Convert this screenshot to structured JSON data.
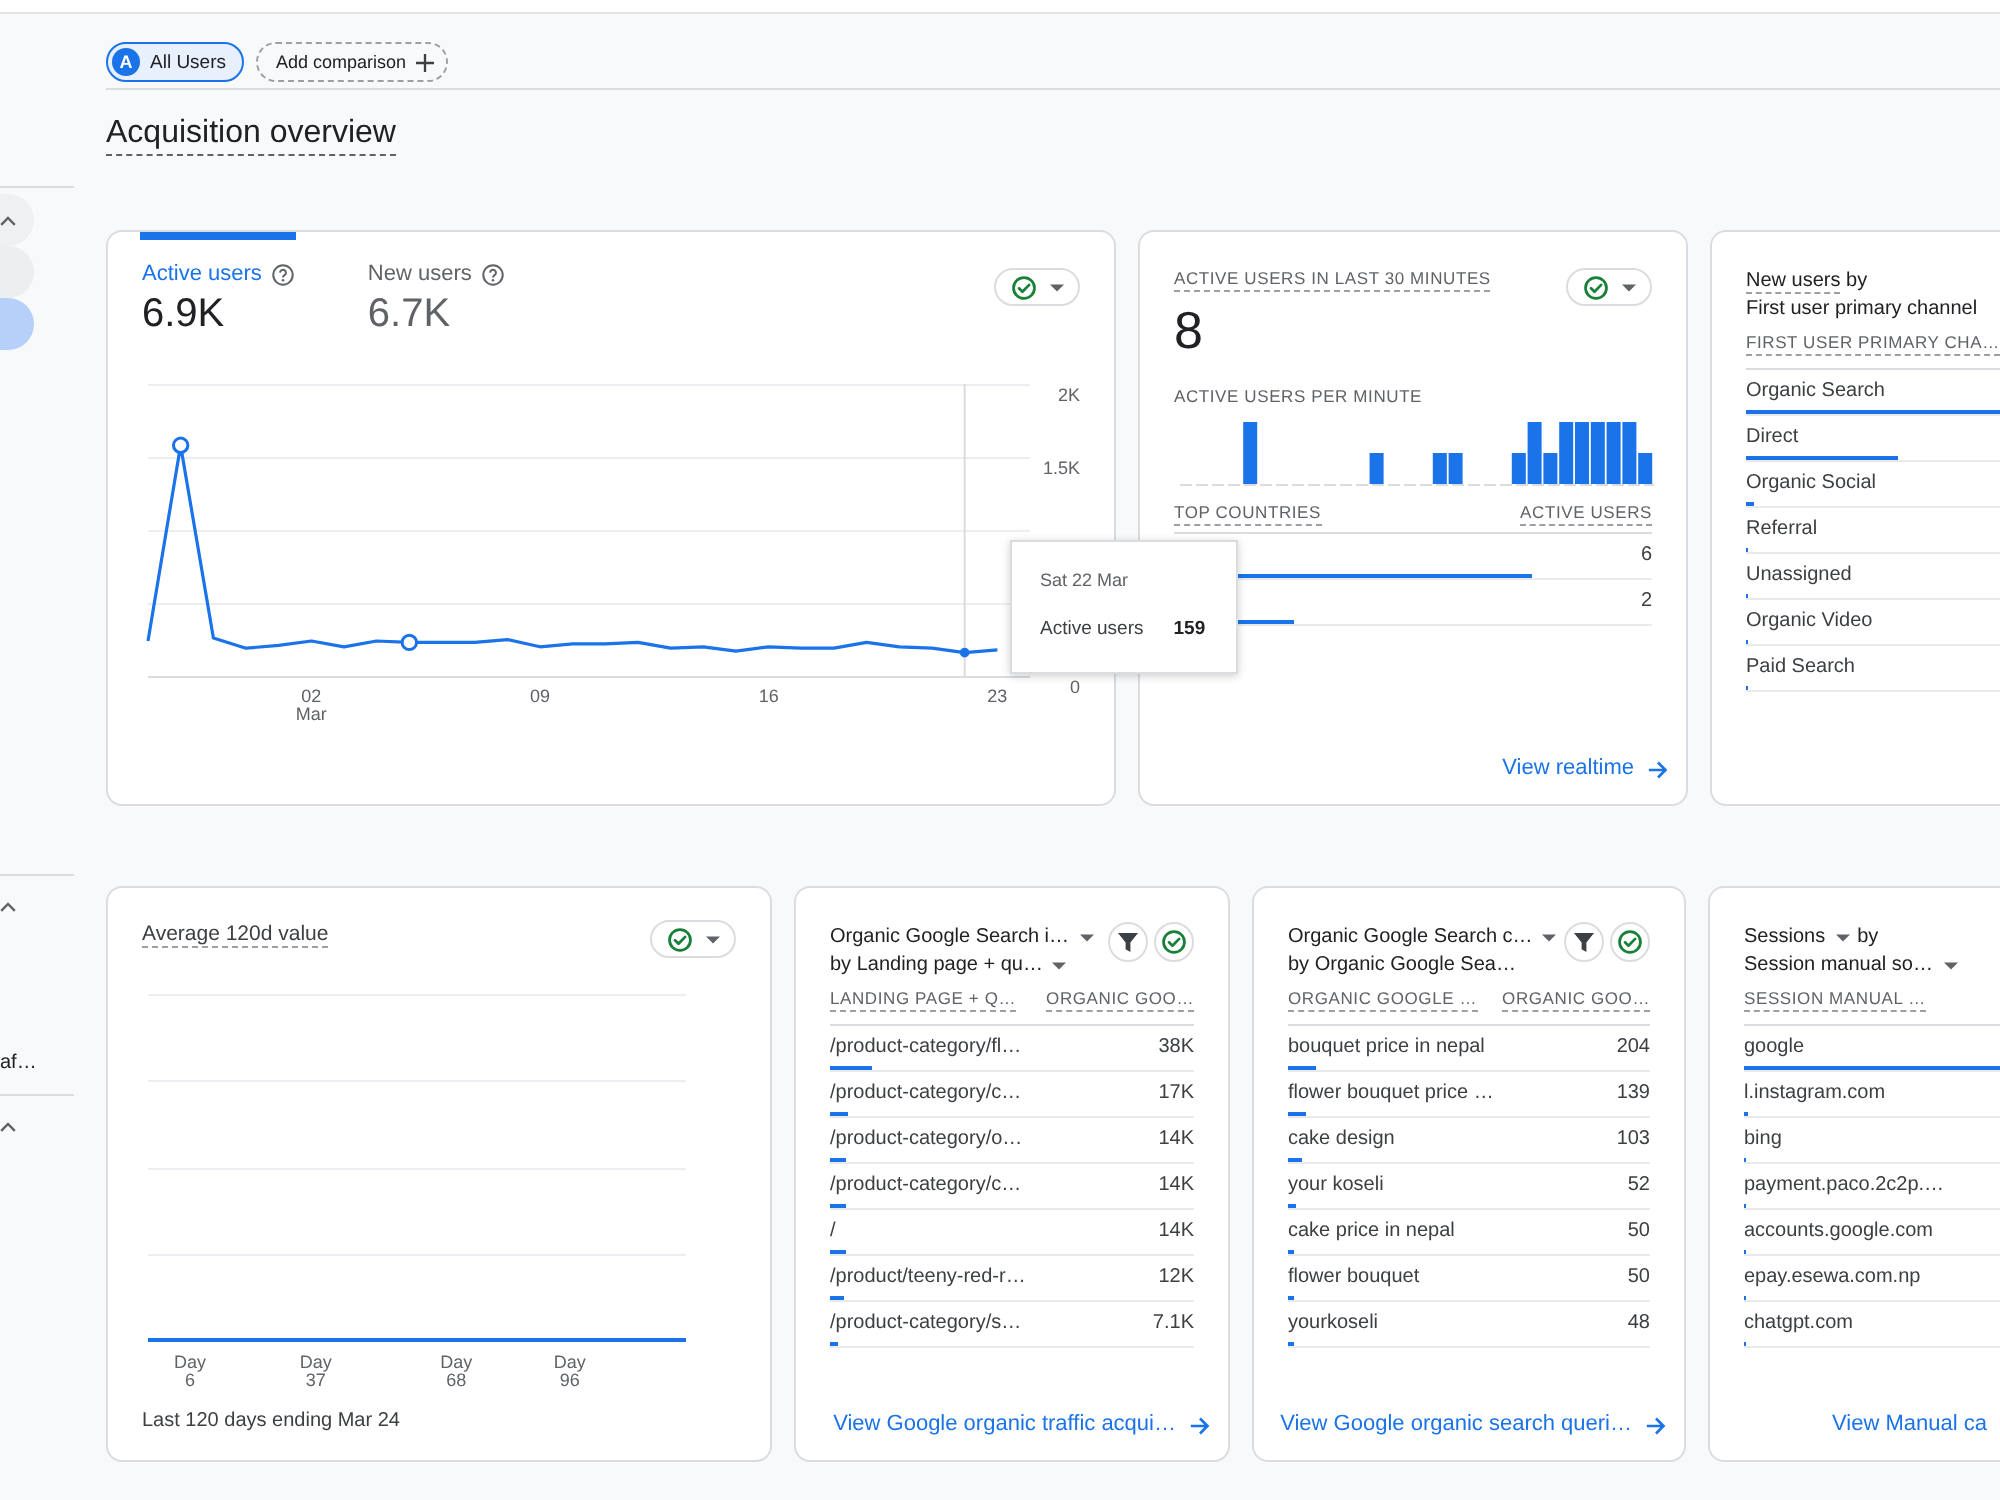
{
  "sidebar": {
    "sections": [
      {
        "expanded": true,
        "hovered": true,
        "items": [
          {
            "selected": false,
            "hovered": true
          },
          {
            "selected": true,
            "hovered": false
          }
        ]
      },
      {
        "expanded": true,
        "hovered": false,
        "items": [
          {
            "label": "af…",
            "selected": false,
            "hovered": false
          }
        ]
      },
      {
        "expanded": true,
        "hovered": false
      }
    ]
  },
  "comparisons": [
    {
      "kind": "segment",
      "avatar": "A",
      "label": "All Users"
    },
    {
      "kind": "add",
      "label": "Add comparison"
    }
  ],
  "page_title": "Acquisition overview",
  "card_rows": [
    {
      "cards": [
        {
          "kind": "metric_chart",
          "metrics": [
            {
              "label": "Active users",
              "value": "6.9K",
              "selected": true
            },
            {
              "label": "New users",
              "value": "6.7K",
              "selected": false
            }
          ],
          "actions": [
            {
              "kind": "check_menu"
            }
          ],
          "chart_data": {
            "type": "line",
            "categories": [
              null,
              null,
              null,
              null,
              null,
              "02 Mar",
              null,
              null,
              null,
              null,
              null,
              null,
              "09",
              null,
              null,
              null,
              null,
              null,
              null,
              "16",
              null,
              null,
              null,
              null,
              null,
              null,
              "23",
              null
            ],
            "series": [
              {
                "color": "#1a73e8",
                "values": [
                  240,
                  1580,
                  260,
                  190,
                  210,
                  240,
                  200,
                  240,
                  230,
                  230,
                  230,
                  250,
                  200,
                  220,
                  220,
                  230,
                  190,
                  200,
                  170,
                  200,
                  190,
                  190,
                  230,
                  200,
                  190,
                  160,
                  180,
                  null
                ]
              }
            ],
            "ylim": [
              0,
              2000
            ],
            "yticks": [
              {
                "value": 0,
                "label": "0"
              },
              {
                "value": 1500,
                "label": "1.5K"
              },
              {
                "value": 2000,
                "label": "2K"
              }
            ]
          },
          "tooltip": {
            "title": "Sat 22 Mar",
            "label": "Active users",
            "value": "159"
          }
        },
        {
          "kind": "realtime",
          "title": "ACTIVE USERS IN LAST 30 MINUTES",
          "value": "8",
          "actions": [
            {
              "kind": "check_menu"
            }
          ],
          "subtitle": "ACTIVE USERS PER MINUTE",
          "columns": [
            "TOP COUNTRIES",
            "ACTIVE USERS"
          ],
          "rows": [
            {
              "value": "6",
              "level": 0.75
            },
            {
              "value": "2",
              "level": 0.25
            }
          ],
          "link": {
            "text": "View realtime",
            "arrow": true
          }
        },
        {
          "kind": "table",
          "title_lines": [
            {
              "text": "New users",
              "suffix": "by",
              "dropdown": false,
              "underlined": true
            },
            {
              "text": "First user primary channel",
              "dropdown": false,
              "underlined": false
            }
          ],
          "columns": [
            "FIRST USER PRIMARY CHA…"
          ],
          "rows": [
            {
              "label": "Organic Search",
              "level": 1
            },
            {
              "label": "Direct",
              "level": 0.32
            },
            {
              "label": "Organic Social",
              "level": 0.015
            },
            {
              "label": "Referral",
              "level": 0.005
            },
            {
              "label": "Unassigned",
              "level": 0.005
            },
            {
              "label": "Organic Video",
              "level": 0.005
            },
            {
              "label": "Paid Search",
              "level": 0.004
            }
          ]
        }
      ]
    },
    {
      "cards": [
        {
          "kind": "value_chart",
          "title": "Average 120d value",
          "actions": [
            {
              "kind": "check_menu"
            }
          ],
          "x_labels": [
            "Day 6",
            "Day 37",
            "Day 68",
            "Day 96"
          ],
          "footer": "Last 120 days ending Mar 24"
        },
        {
          "kind": "table",
          "title_lines": [
            {
              "text": "Organic Google Search i…",
              "dropdown": true,
              "underlined": false
            },
            {
              "text": "by Landing page + qu…",
              "dropdown": true,
              "underlined": false
            }
          ],
          "actions": [
            {
              "kind": "filter"
            },
            {
              "kind": "check"
            }
          ],
          "columns": [
            "LANDING PAGE + Q…",
            "ORGANIC GOO…"
          ],
          "rows": [
            {
              "label": "/product-category/fl…",
              "value": "38K",
              "level": 0.114
            },
            {
              "label": "/product-category/c…",
              "value": "17K",
              "level": 0.051
            },
            {
              "label": "/product-category/o…",
              "value": "14K",
              "level": 0.042
            },
            {
              "label": "/product-category/c…",
              "value": "14K",
              "level": 0.042
            },
            {
              "label": "/",
              "value": "14K",
              "level": 0.042
            },
            {
              "label": "/product/teeny-red-r…",
              "value": "12K",
              "level": 0.036
            },
            {
              "label": "/product-category/s…",
              "value": "7.1K",
              "level": 0.021
            }
          ],
          "link": {
            "text": "View Google organic traffic acqui…",
            "arrow": true
          }
        },
        {
          "kind": "table",
          "title_lines": [
            {
              "text": "Organic Google Search c…",
              "dropdown": true,
              "underlined": false
            },
            {
              "text": "by Organic Google Sea…",
              "dropdown": false,
              "underlined": false
            }
          ],
          "actions": [
            {
              "kind": "filter"
            },
            {
              "kind": "check"
            }
          ],
          "columns": [
            "ORGANIC GOOGLE …",
            "ORGANIC GOO…"
          ],
          "rows": [
            {
              "label": "bouquet price in nepal",
              "value": "204",
              "level": 0.077
            },
            {
              "label": "flower bouquet price …",
              "value": "139",
              "level": 0.052
            },
            {
              "label": "cake design",
              "value": "103",
              "level": 0.039
            },
            {
              "label": "your koseli",
              "value": "52",
              "level": 0.02
            },
            {
              "label": "cake price in nepal",
              "value": "50",
              "level": 0.019
            },
            {
              "label": "flower bouquet",
              "value": "50",
              "level": 0.019
            },
            {
              "label": "yourkoseli",
              "value": "48",
              "level": 0.018
            }
          ],
          "link": {
            "text": "View Google organic search queri…",
            "arrow": true
          }
        },
        {
          "kind": "table",
          "title_lines": [
            {
              "text": "Sessions",
              "suffix": "by",
              "dropdown": true,
              "underlined": false
            },
            {
              "text": "Session manual so…",
              "dropdown": true,
              "underlined": false
            }
          ],
          "columns": [
            "SESSION MANUAL …"
          ],
          "rows": [
            {
              "label": "google",
              "level": 1
            },
            {
              "label": "l.instagram.com",
              "level": 0.008
            },
            {
              "label": "bing",
              "level": 0.004
            },
            {
              "label": "payment.paco.2c2p.…",
              "level": 0.004
            },
            {
              "label": "accounts.google.com",
              "level": 0.004
            },
            {
              "label": "epay.esewa.com.np",
              "level": 0.004
            },
            {
              "label": "chatgpt.com",
              "level": 0.004
            }
          ],
          "link": {
            "text": "View Manual ca",
            "arrow": false
          }
        }
      ]
    }
  ]
}
